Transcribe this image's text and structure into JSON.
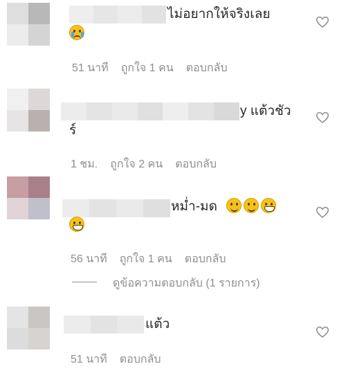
{
  "comments": [
    {
      "text": "ไม่อยากให้จริงเลย",
      "text2": "",
      "emojis": [
        "crying-face-emoji"
      ],
      "time": "51 นาที",
      "likes": "ถูกใจ 1 คน",
      "reply": "ตอบกลับ"
    },
    {
      "text": "y แต้วชัว",
      "text2": "ร์",
      "emojis": [],
      "time": "1 ชม.",
      "likes": "ถูกใจ 2 คน",
      "reply": "ตอบกลับ"
    },
    {
      "text": "หม่ำ-มด",
      "text2": "",
      "emojis": [
        "smiling-face-emoji",
        "smiling-face-emoji",
        "grinning-face-emoji",
        "grinning-face-emoji"
      ],
      "time": "56 นาที",
      "likes": "ถูกใจ 1 คน",
      "reply": "ตอบกลับ",
      "view_replies": "ดูข้อความตอบกลับ (1 รายการ)"
    },
    {
      "text": "แต้ว",
      "text2": "",
      "emojis": [],
      "time": "51 นาที",
      "likes": "",
      "reply": "ตอบกลับ"
    }
  ],
  "colors": {
    "text": "#262626",
    "meta": "#8e8e8e",
    "blur": "#e6e6e6",
    "emoji": "#f5c21b"
  },
  "icons": [
    "heart-outline-icon"
  ]
}
